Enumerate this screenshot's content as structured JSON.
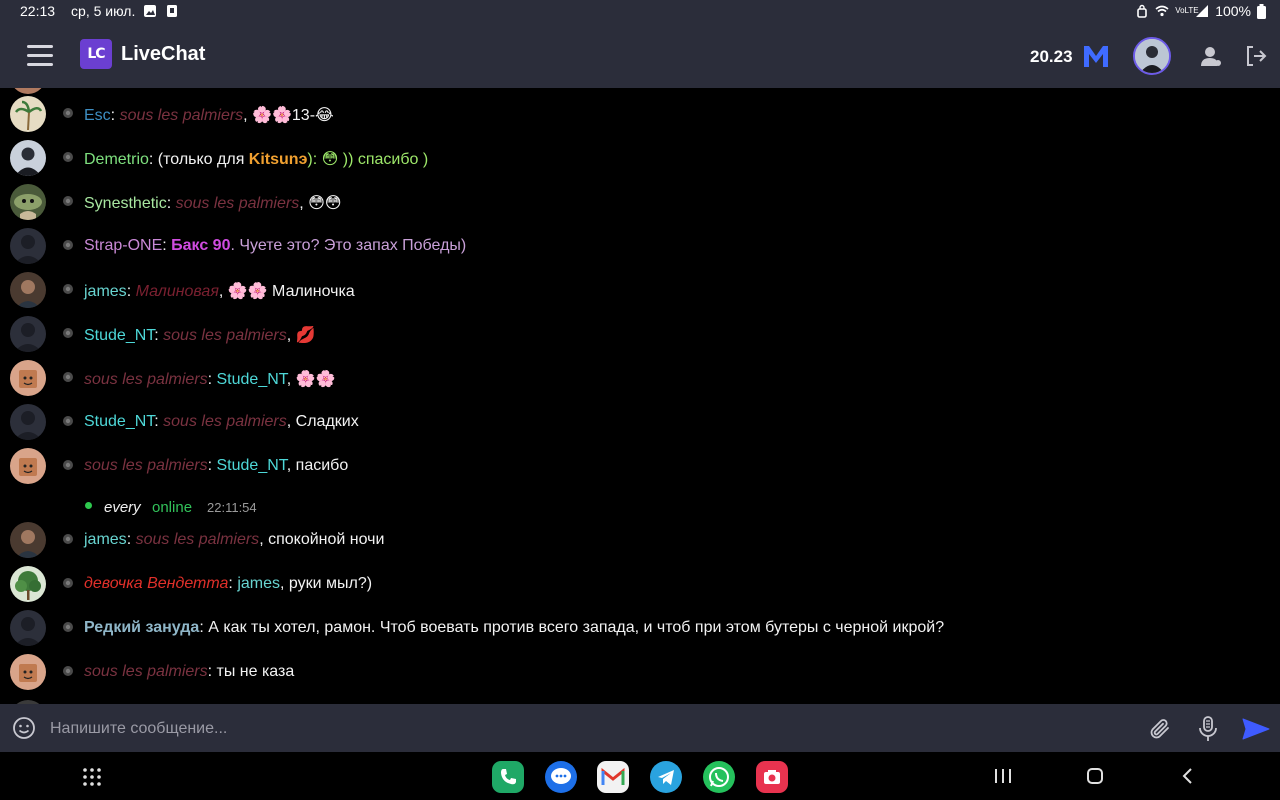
{
  "status_bar": {
    "time": "22:13",
    "date": "ср, 5 июл.",
    "battery": "100%",
    "network": "VoLTE"
  },
  "header": {
    "logo_mark": "LC",
    "app_name": "LiveChat",
    "balance": "20.23",
    "currency_icon": "m-currency-icon"
  },
  "colors": {
    "header_bg": "#2b2d3a",
    "accent": "#6b3fd1",
    "online_green": "#32c25a",
    "send_blue": "#3f5bff"
  },
  "messages": [
    {
      "avatar": "palm-tree-avatar",
      "parts": [
        {
          "t": "Esc",
          "c": "#3e8ec2"
        },
        {
          "t": ": ",
          "c": "#f2f2f2"
        },
        {
          "t": "sous les palmiers",
          "c": "#7a3240",
          "i": true
        },
        {
          "t": ", 🌸🌸13-😂",
          "c": "#f2f2f2"
        }
      ]
    },
    {
      "avatar": "man-avatar",
      "parts": [
        {
          "t": "Demetrio",
          "c": "#7ee07e"
        },
        {
          "t": ": (только для ",
          "c": "#f2f2f2"
        },
        {
          "t": "Kitsunэ",
          "c": "#f0a030",
          "b": true
        },
        {
          "t": "): 😳 )) спасибо )",
          "c": "#9ee86a"
        }
      ]
    },
    {
      "avatar": "yoda-avatar",
      "parts": [
        {
          "t": "Synesthetic",
          "c": "#a8e6a0"
        },
        {
          "t": ": ",
          "c": "#f2f2f2"
        },
        {
          "t": "sous les palmiers",
          "c": "#7a3240",
          "i": true
        },
        {
          "t": ", 😳😳",
          "c": "#f2f2f2"
        }
      ]
    },
    {
      "avatar": "default-avatar",
      "parts": [
        {
          "t": "Strap-ONE",
          "c": "#c989d6"
        },
        {
          "t": ": ",
          "c": "#f2f2f2"
        },
        {
          "t": "Бакс 90",
          "c": "#d04ce0",
          "b": true
        },
        {
          "t": ". Чуете это? Это запах Победы)",
          "c": "#c9a0d8"
        }
      ]
    },
    {
      "avatar": "james-avatar",
      "parts": [
        {
          "t": "james",
          "c": "#68d4d0"
        },
        {
          "t": ": ",
          "c": "#f2f2f2"
        },
        {
          "t": "Малиновая",
          "c": "#7a2030",
          "i": true
        },
        {
          "t": ", 🌸🌸 Малиночка",
          "c": "#f2f2f2"
        }
      ]
    },
    {
      "avatar": "default-avatar",
      "parts": [
        {
          "t": "Stude_NT",
          "c": "#4ed8d8"
        },
        {
          "t": ": ",
          "c": "#f2f2f2"
        },
        {
          "t": "sous les palmiers",
          "c": "#7a3240",
          "i": true
        },
        {
          "t": ", 💋",
          "c": "#f2f2f2"
        }
      ]
    },
    {
      "avatar": "box-avatar",
      "parts": [
        {
          "t": "sous les palmiers",
          "c": "#7a3240",
          "i": true
        },
        {
          "t": ": ",
          "c": "#f2f2f2"
        },
        {
          "t": "Stude_NT",
          "c": "#4ed8d8"
        },
        {
          "t": ", 🌸🌸",
          "c": "#f2f2f2"
        }
      ]
    },
    {
      "avatar": "default-avatar",
      "parts": [
        {
          "t": "Stude_NT",
          "c": "#4ed8d8"
        },
        {
          "t": ": ",
          "c": "#f2f2f2"
        },
        {
          "t": "sous les palmiers",
          "c": "#7a3240",
          "i": true
        },
        {
          "t": ", Сладких",
          "c": "#f2f2f2"
        }
      ]
    },
    {
      "avatar": "box-avatar",
      "parts": [
        {
          "t": "sous les palmiers",
          "c": "#7a3240",
          "i": true
        },
        {
          "t": ": ",
          "c": "#f2f2f2"
        },
        {
          "t": "Stude_NT",
          "c": "#4ed8d8"
        },
        {
          "t": ", пасибо",
          "c": "#f2f2f2"
        }
      ]
    }
  ],
  "system_event": {
    "user": "every",
    "status": "online",
    "time": "22:11:54"
  },
  "messages_after": [
    {
      "avatar": "james-avatar",
      "parts": [
        {
          "t": "james",
          "c": "#68d4d0"
        },
        {
          "t": ": ",
          "c": "#f2f2f2"
        },
        {
          "t": "sous les palmiers",
          "c": "#7a3240",
          "i": true
        },
        {
          "t": ", спокойной ночи",
          "c": "#f2f2f2"
        }
      ]
    },
    {
      "avatar": "tree-avatar",
      "parts": [
        {
          "t": "девочка Вендетта",
          "c": "#e0302a",
          "i": true
        },
        {
          "t": ": ",
          "c": "#f2f2f2"
        },
        {
          "t": "james",
          "c": "#68d4d0"
        },
        {
          "t": ", руки мыл?)",
          "c": "#f2f2f2"
        }
      ]
    },
    {
      "avatar": "default-avatar",
      "parts": [
        {
          "t": "Редкий зануда",
          "c": "#8fb6c8",
          "b": true
        },
        {
          "t": ": А как ты хотел, рамон. Чтоб воевать против всего запада, и чтоб при этом бутеры с черной икрой?",
          "c": "#f2f2f2"
        }
      ]
    },
    {
      "avatar": "box-avatar",
      "parts": [
        {
          "t": "sous les palmiers",
          "c": "#7a3240",
          "i": true
        },
        {
          "t": ": ты не каза",
          "c": "#f2f2f2"
        }
      ]
    }
  ],
  "input": {
    "placeholder": "Напишите сообщение..."
  },
  "dock_apps": [
    "phone-app-icon",
    "messages-app-icon",
    "gmail-app-icon",
    "telegram-app-icon",
    "whatsapp-app-icon",
    "camera-app-icon"
  ]
}
